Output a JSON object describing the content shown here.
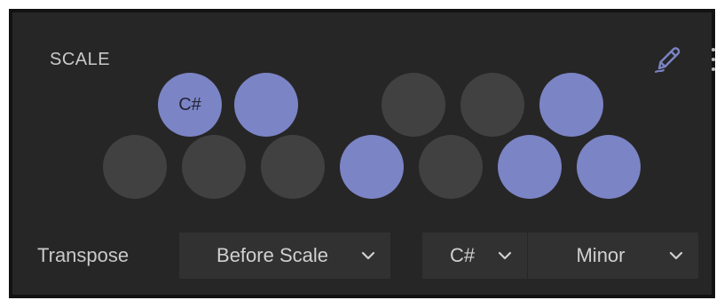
{
  "panel": {
    "title": "SCALE",
    "edit_icon": "pencil-icon",
    "menu_icon": "kebab-menu-icon",
    "accent_color": "#7b84c5",
    "inactive_color": "#414141"
  },
  "keys": {
    "black": [
      {
        "label": "C#",
        "active": true
      },
      {
        "label": "",
        "active": true
      },
      {
        "label": "",
        "active": false
      },
      {
        "label": "",
        "active": false
      },
      {
        "label": "",
        "active": true
      }
    ],
    "white": [
      {
        "label": "",
        "active": false
      },
      {
        "label": "",
        "active": false
      },
      {
        "label": "",
        "active": false
      },
      {
        "label": "",
        "active": true
      },
      {
        "label": "",
        "active": false
      },
      {
        "label": "",
        "active": true
      },
      {
        "label": "",
        "active": true
      }
    ]
  },
  "transpose": {
    "label": "Transpose",
    "selected": "Before Scale"
  },
  "root_key": {
    "selected": "C#"
  },
  "mode": {
    "selected": "Minor"
  }
}
